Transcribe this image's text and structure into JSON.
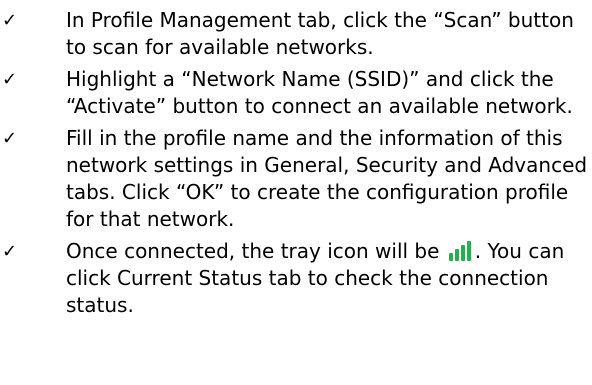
{
  "checklist": {
    "check_glyph": "✓",
    "steps": [
      {
        "text": "In Profile Management tab, click the “Scan” button to scan for available networks."
      },
      {
        "text": "Highlight a “Network Name (SSID)” and click the “Activate” button to connect an available network."
      },
      {
        "text": "Fill in the profile name and the information of this network settings in General, Security and Advanced tabs. Click “OK” to create the configuration profile for that network."
      },
      {
        "text_before": "Once connected, the tray icon will be ",
        "tray_icon": "signal-bars-icon",
        "tray_icon_color": "#21b24b",
        "text_after": ". You can click Current Status tab to check the connection status."
      }
    ]
  }
}
